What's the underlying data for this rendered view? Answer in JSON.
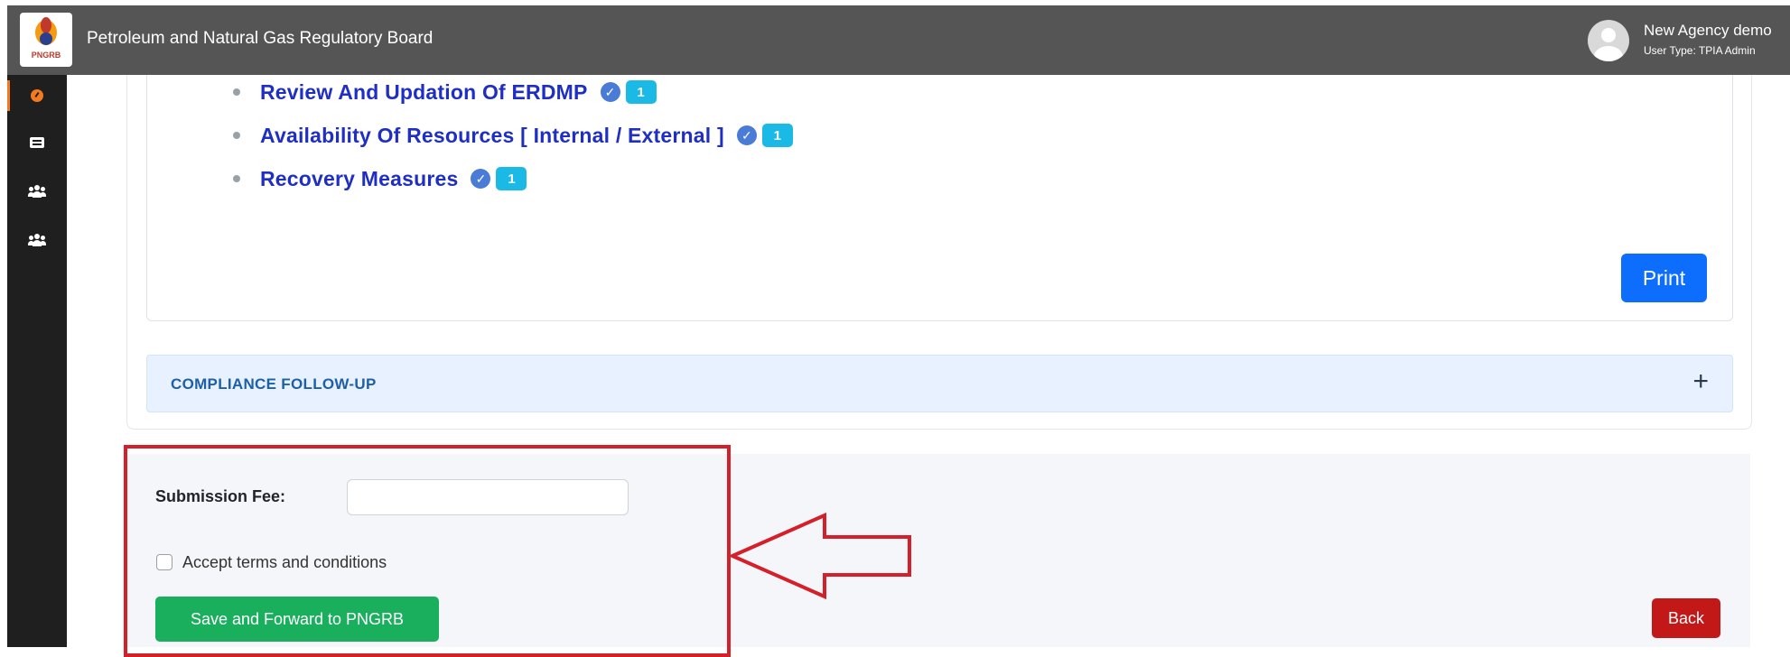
{
  "header": {
    "logo_text": "PNGRB",
    "app_title": "Petroleum and Natural Gas Regulatory Board",
    "user_name": "New Agency demo",
    "user_type": "User Type: TPIA Admin"
  },
  "sidebar": {
    "items": [
      {
        "icon": "dashboard-icon",
        "active": true
      },
      {
        "icon": "list-icon",
        "active": false
      },
      {
        "icon": "users-icon",
        "active": false
      },
      {
        "icon": "users-icon",
        "active": false
      }
    ]
  },
  "sections": [
    {
      "label": "Review And Updation Of ERDMP",
      "count": "1"
    },
    {
      "label": "Availability Of Resources [ Internal / External ]",
      "count": "1"
    },
    {
      "label": "Recovery Measures",
      "count": "1"
    }
  ],
  "print_label": "Print",
  "compliance": {
    "title": "COMPLIANCE FOLLOW-UP",
    "toggle": "+"
  },
  "form": {
    "fee_label": "Submission Fee:",
    "fee_value": "",
    "terms_label": "Accept terms and conditions",
    "save_label": "Save and Forward to PNGRB",
    "back_label": "Back"
  },
  "colors": {
    "accent": "#0d6efd",
    "save": "#1aaf5d",
    "back": "#c21818",
    "annotation": "#d4202a"
  }
}
